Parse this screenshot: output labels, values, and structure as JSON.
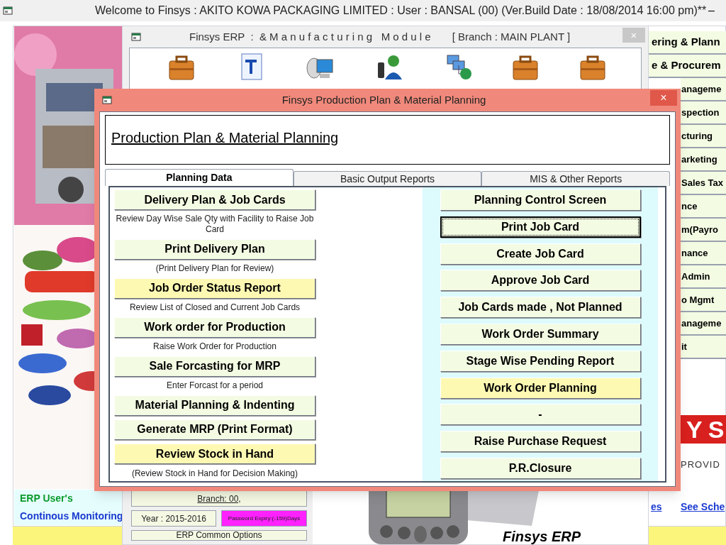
{
  "window": {
    "title": "Welcome to Finsys : AKITO KOWA PACKAGING LIMITED : User : BANSAL (00) (Ver.Build Date : 18/08/2014 16:00 pm)**",
    "minimize": "–"
  },
  "background": {
    "side_menu": [
      "ering & Plann",
      "e & Procurem",
      "anageme",
      "spection",
      "cturing",
      "arketing",
      "Sales Tax",
      "nce",
      "m(Payro",
      "nance",
      "Admin",
      "o Mgmt",
      "anageme",
      "it"
    ],
    "promo_lines": [
      "ERP User's",
      "Continous Monitoring"
    ],
    "brand_band": "YS",
    "tagline": "PROVID",
    "links": [
      "es",
      "See Sche"
    ]
  },
  "erp_window": {
    "title": "Finsys ERP  :  & M a n u f a c t u r i n g   M o d u l e",
    "branch": "[ Branch : MAIN PLANT ]",
    "close": "×",
    "branch_button": "Branch: 00,",
    "year_button": "Year : 2015-2016",
    "password_badge": "Password Expiry:(-159)Days",
    "common_options": "ERP Common Options",
    "product_name": "Finsys ERP"
  },
  "dialog": {
    "title": "Finsys Production Plan & Material Planning",
    "close": "×",
    "heading": "Production Plan & Material Planning",
    "tabs": [
      {
        "label": "Planning Data",
        "selected": true
      },
      {
        "label": "Basic Output Reports",
        "selected": false
      },
      {
        "label": "MIS & Other Reports",
        "selected": false
      }
    ],
    "left_items": [
      {
        "kind": "button",
        "label": "Delivery Plan & Job Cards",
        "highlighted": false
      },
      {
        "kind": "caption",
        "label": "Review Day Wise Sale Qty with Facility to Raise Job Card"
      },
      {
        "kind": "button",
        "label": "Print Delivery Plan",
        "highlighted": false
      },
      {
        "kind": "caption",
        "label": "(Print Delivery Plan for Review)"
      },
      {
        "kind": "button",
        "label": "Job Order Status Report",
        "highlighted": true
      },
      {
        "kind": "caption",
        "label": "Review List of Closed and Current Job Cards"
      },
      {
        "kind": "button",
        "label": "Work order for Production",
        "highlighted": false
      },
      {
        "kind": "caption",
        "label": "Raise Work Order for Production"
      },
      {
        "kind": "button",
        "label": "Sale Forcasting for MRP",
        "highlighted": false
      },
      {
        "kind": "caption",
        "label": "Enter Forcast for a period"
      },
      {
        "kind": "button",
        "label": "Material Planning & Indenting",
        "highlighted": false
      },
      {
        "kind": "button",
        "label": "Generate MRP (Print Format)",
        "highlighted": false
      },
      {
        "kind": "button",
        "label": "Review Stock in Hand",
        "highlighted": true
      },
      {
        "kind": "caption",
        "label": "(Review Stock in Hand for Decision Making)"
      }
    ],
    "right_buttons": [
      {
        "label": "Planning Control Screen",
        "highlighted": false,
        "focused": false
      },
      {
        "label": "Print Job Card",
        "highlighted": false,
        "focused": true
      },
      {
        "label": "Create Job Card",
        "highlighted": false,
        "focused": false
      },
      {
        "label": "Approve Job Card",
        "highlighted": false,
        "focused": false
      },
      {
        "label": "Job Cards made , Not Planned",
        "highlighted": false,
        "focused": false
      },
      {
        "label": "Work Order Summary",
        "highlighted": false,
        "focused": false
      },
      {
        "label": "Stage Wise Pending Report",
        "highlighted": false,
        "focused": false
      },
      {
        "label": "Work Order Planning",
        "highlighted": true,
        "focused": false
      },
      {
        "label": "-",
        "highlighted": false,
        "focused": false
      },
      {
        "label": "Raise Purchase Request",
        "highlighted": false,
        "focused": false
      },
      {
        "label": "P.R.Closure",
        "highlighted": false,
        "focused": false
      }
    ]
  }
}
